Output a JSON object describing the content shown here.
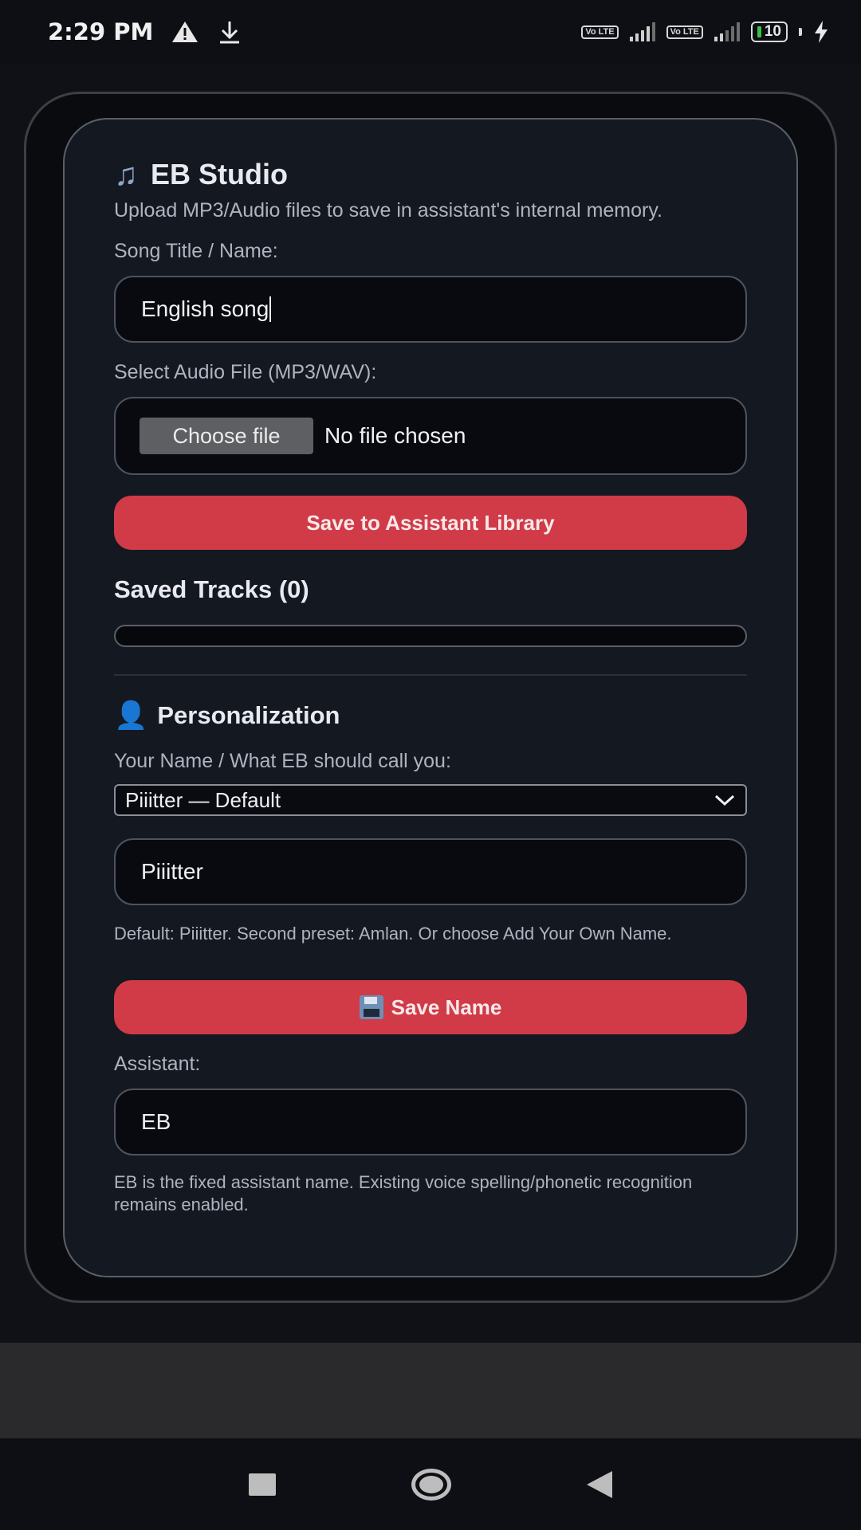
{
  "status_bar": {
    "time": "2:29 PM",
    "volte_1": "Vo LTE",
    "volte_2": "Vo LTE",
    "battery": "10"
  },
  "studio": {
    "title": "EB Studio",
    "subtitle": "Upload MP3/Audio files to save in assistant's internal memory.",
    "song_title_label": "Song Title / Name:",
    "song_title_value": "English song",
    "audio_file_label": "Select Audio File (MP3/WAV):",
    "choose_file_label": "Choose file",
    "no_file_text": "No file chosen",
    "save_button": "Save to Assistant Library",
    "saved_tracks_heading": "Saved Tracks (0)"
  },
  "personalization": {
    "heading": "Personalization",
    "name_label": "Your Name / What EB should call you:",
    "name_select_value": "Piiitter — Default",
    "name_input_value": "Piiitter",
    "name_hint": "Default: Piiitter. Second preset: Amlan. Or choose Add Your Own Name.",
    "save_name_button": "Save Name",
    "assistant_label": "Assistant:",
    "assistant_value": "EB",
    "assistant_hint": "EB is the fixed assistant name. Existing voice spelling/phonetic recognition remains enabled."
  },
  "colors": {
    "accent": "#d13a47",
    "panel": "#141821",
    "input_bg": "#080a0f"
  }
}
